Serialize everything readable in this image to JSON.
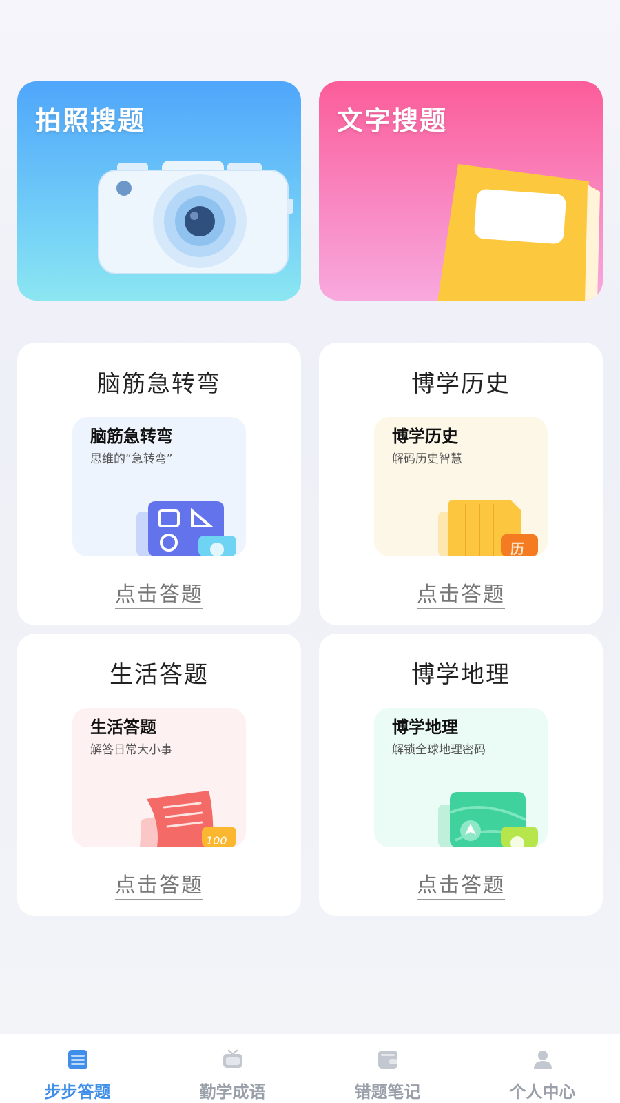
{
  "top_cards": {
    "photo_search": {
      "title": "拍照搜题"
    },
    "text_search": {
      "title": "文字搜题"
    }
  },
  "categories": [
    {
      "title": "脑筋急转弯",
      "inner_title": "脑筋急转弯",
      "inner_subtitle": "思维的“急转弯”",
      "cta": "点击答题",
      "bg": "#eef4fd"
    },
    {
      "title": "博学历史",
      "inner_title": "博学历史",
      "inner_subtitle": "解码历史智慧",
      "cta": "点击答题",
      "bg": "#fdf7e8"
    },
    {
      "title": "生活答题",
      "inner_title": "生活答题",
      "inner_subtitle": "解答日常大小事",
      "cta": "点击答题",
      "bg": "#fdf1f1"
    },
    {
      "title": "博学地理",
      "inner_title": "博学地理",
      "inner_subtitle": "解锁全球地理密码",
      "cta": "点击答题",
      "bg": "#ebfbf6"
    }
  ],
  "tabbar": {
    "tabs": [
      {
        "label": "步步答题",
        "icon": "document-list-icon",
        "active": true
      },
      {
        "label": "勤学成语",
        "icon": "tv-icon",
        "active": false
      },
      {
        "label": "错题笔记",
        "icon": "wallet-icon",
        "active": false
      },
      {
        "label": "个人中心",
        "icon": "person-icon",
        "active": false
      }
    ]
  },
  "colors": {
    "accent": "#3f8ee9",
    "inactive": "#9aa0aa"
  }
}
